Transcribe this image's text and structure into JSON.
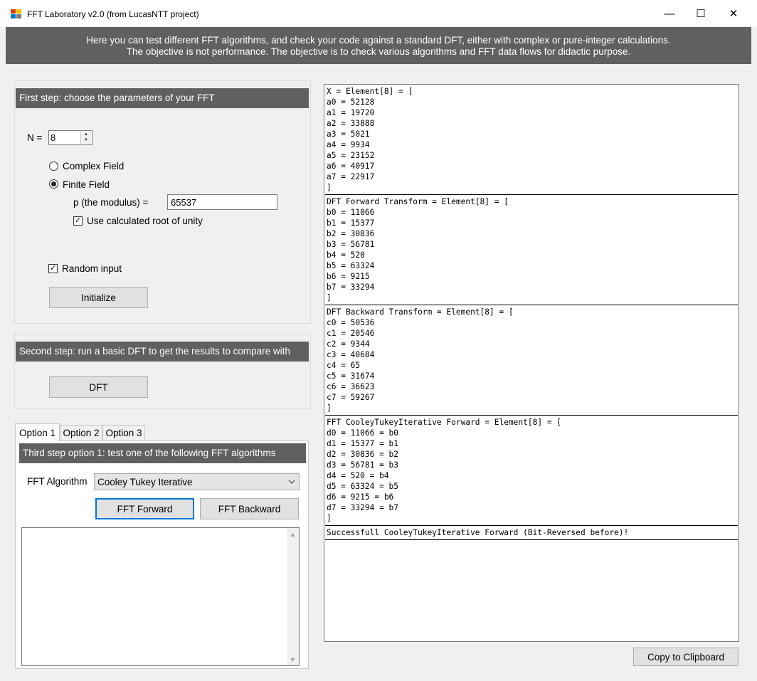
{
  "window": {
    "title": "FFT Laboratory v2.0 (from LucasNTT project)",
    "minimize_glyph": "—",
    "maximize_glyph": "☐",
    "close_glyph": "✕"
  },
  "banner": {
    "line1": "Here you can test different FFT algorithms, and check your code against a standard DFT,  either with complex or pure-integer calculations.",
    "line2": "The objective is not performance. The objective is to check various algorithms and FFT data flows for didactic purpose."
  },
  "step1": {
    "header": "First step: choose the parameters of your FFT",
    "n_label": "N =",
    "n_value": "8",
    "complex_field_label": "Complex Field",
    "finite_field_label": "Finite Field",
    "selected_field": "Finite Field",
    "modulus_label": "p (the modulus) =",
    "modulus_value": "65537",
    "root_of_unity_label": "Use calculated root of unity",
    "root_of_unity_checked": true,
    "random_input_label": "Random input",
    "random_input_checked": true,
    "initialize_button": "Initialize"
  },
  "step2": {
    "header": "Second step: run a basic DFT to get the results to compare with",
    "dft_button": "DFT"
  },
  "step3": {
    "tabs": [
      {
        "label": "Option 1",
        "active": true
      },
      {
        "label": "Option 2",
        "active": false
      },
      {
        "label": "Option 3",
        "active": false
      }
    ],
    "header": "Third step option 1: test one of the following FFT algorithms",
    "algorithm_label": "FFT Algorithm",
    "algorithm_value": "Cooley Tukey Iterative",
    "fft_forward_button": "FFT Forward",
    "fft_backward_button": "FFT Backward",
    "log_text": ""
  },
  "output": {
    "blocks": [
      [
        "X = Element[8] = [",
        "a0 = 52128",
        "a1 = 19720",
        "a2 = 33888",
        "a3 = 5021",
        "a4 = 9934",
        "a5 = 23152",
        "a6 = 40917",
        "a7 = 22917",
        "]"
      ],
      [
        "DFT Forward Transform = Element[8] = [",
        "b0 = 11066",
        "b1 = 15377",
        "b2 = 30836",
        "b3 = 56781",
        "b4 = 520",
        "b5 = 63324",
        "b6 = 9215",
        "b7 = 33294",
        "]"
      ],
      [
        "DFT Backward Transform = Element[8] = [",
        "c0 = 50536",
        "c1 = 20546",
        "c2 = 9344",
        "c3 = 40684",
        "c4 = 65",
        "c5 = 31674",
        "c6 = 36623",
        "c7 = 59267",
        "]"
      ],
      [
        "FFT CooleyTukeyIterative Forward = Element[8] = [",
        "d0 = 11066 = b0",
        "d1 = 15377 = b1",
        "d2 = 30836 = b2",
        "d3 = 56781 = b3",
        "d4 = 520 = b4",
        "d5 = 63324 = b5",
        "d6 = 9215 = b6",
        "d7 = 33294 = b7",
        "]"
      ],
      [
        "Successfull CooleyTukeyIterative Forward (Bit-Reversed before)!"
      ]
    ]
  },
  "copy_button": "Copy to Clipboard",
  "colors": {
    "header_bg": "#606060",
    "window_bg": "#f0f0f0",
    "focus_blue": "#0078d7"
  }
}
